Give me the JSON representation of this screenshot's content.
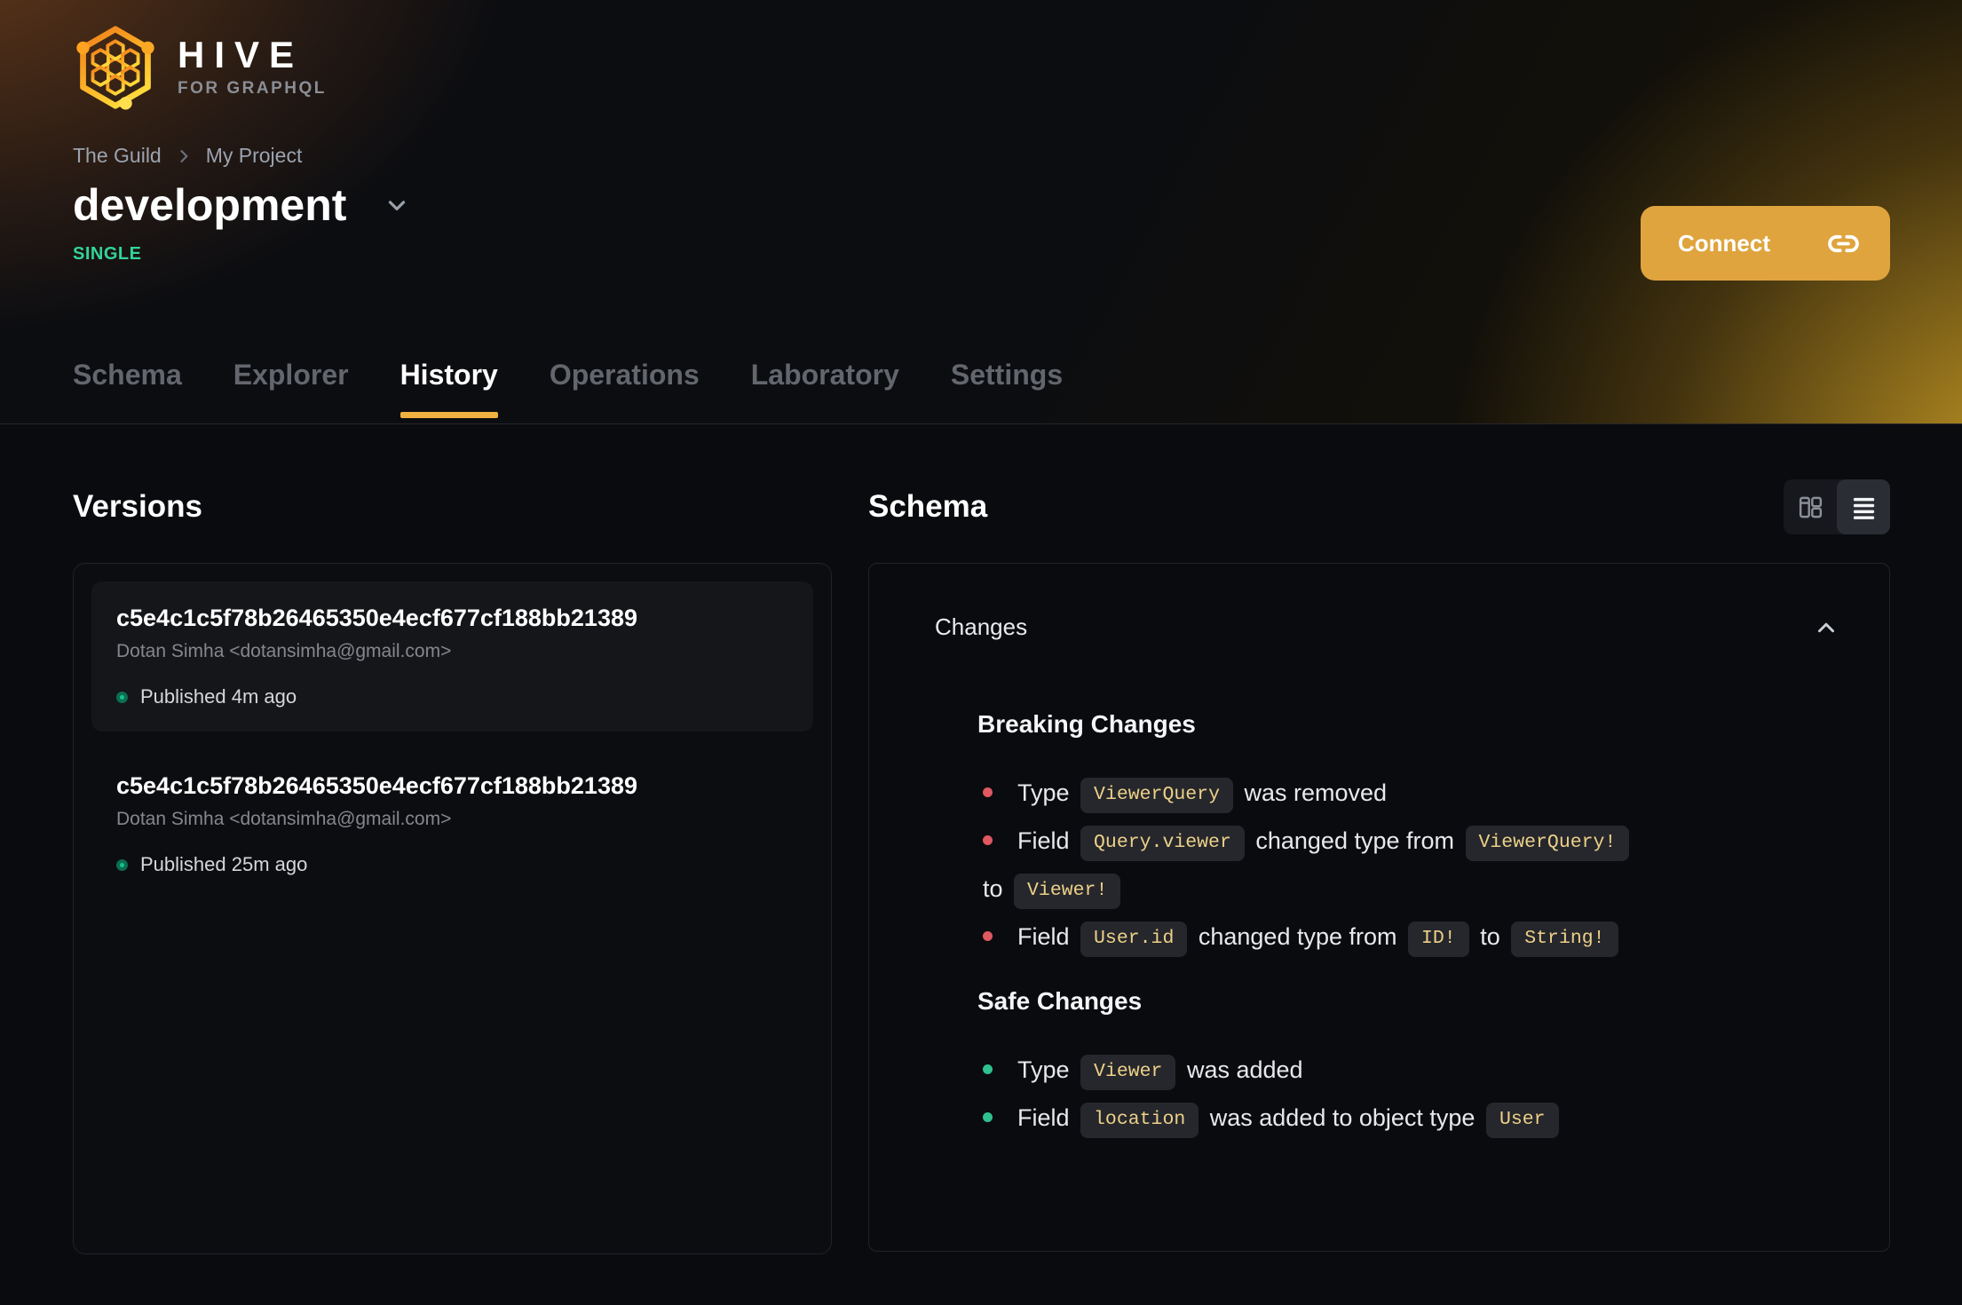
{
  "colors": {
    "accent": "#dfa43e",
    "tab_underline": "#efb13f",
    "badge": "#34d399",
    "breaking_bullet": "#e05861",
    "safe_bullet": "#2fc08f",
    "code_text": "#edd189",
    "brand_orange": "#f07d1c",
    "brand_yellow": "#ffd83a",
    "published_dot": "#19c08d"
  },
  "brand": {
    "name": "HIVE",
    "tagline": "FOR GRAPHQL",
    "logo_icon": "hive-hexagon-logo"
  },
  "breadcrumb": {
    "org": "The Guild",
    "project": "My Project",
    "separator_icon": "chevron-right"
  },
  "target": {
    "name": "development",
    "badge": "SINGLE",
    "dropdown_icon": "chevron-down"
  },
  "connect": {
    "label": "Connect",
    "icon": "link"
  },
  "tabs": [
    {
      "label": "Schema",
      "active": false
    },
    {
      "label": "Explorer",
      "active": false
    },
    {
      "label": "History",
      "active": true
    },
    {
      "label": "Operations",
      "active": false
    },
    {
      "label": "Laboratory",
      "active": false
    },
    {
      "label": "Settings",
      "active": false
    }
  ],
  "versions": {
    "heading": "Versions",
    "items": [
      {
        "hash": "c5e4c1c5f78b26465350e4ecf677cf188bb21389",
        "author": "Dotan Simha <dotansimha@gmail.com>",
        "status": "Published 4m ago",
        "selected": true
      },
      {
        "hash": "c5e4c1c5f78b26465350e4ecf677cf188bb21389",
        "author": "Dotan Simha <dotansimha@gmail.com>",
        "status": "Published 25m ago",
        "selected": false
      }
    ]
  },
  "schema": {
    "heading": "Schema",
    "view_toggle": {
      "split_icon": "columns-view",
      "list_icon": "list-view",
      "active": "list"
    },
    "changes": {
      "title": "Changes",
      "collapse_icon": "chevron-up",
      "breaking": {
        "heading": "Breaking Changes",
        "items": [
          {
            "segments": [
              [
                "text",
                "Type "
              ],
              [
                "code",
                "ViewerQuery"
              ],
              [
                "text",
                " was removed"
              ]
            ]
          },
          {
            "segments": [
              [
                "text",
                "Field "
              ],
              [
                "code",
                "Query.viewer"
              ],
              [
                "text",
                " changed type from "
              ],
              [
                "code",
                "ViewerQuery!"
              ],
              [
                "br",
                ""
              ],
              [
                "text",
                "to "
              ],
              [
                "code",
                "Viewer!"
              ]
            ]
          },
          {
            "segments": [
              [
                "text",
                "Field "
              ],
              [
                "code",
                "User.id"
              ],
              [
                "text",
                " changed type from "
              ],
              [
                "code",
                "ID!"
              ],
              [
                "text",
                " to "
              ],
              [
                "code",
                "String!"
              ]
            ]
          }
        ]
      },
      "safe": {
        "heading": "Safe Changes",
        "items": [
          {
            "segments": [
              [
                "text",
                "Type "
              ],
              [
                "code",
                "Viewer"
              ],
              [
                "text",
                " was added"
              ]
            ]
          },
          {
            "segments": [
              [
                "text",
                "Field "
              ],
              [
                "code",
                "location"
              ],
              [
                "text",
                " was added to object type "
              ],
              [
                "code",
                "User"
              ]
            ]
          }
        ]
      }
    }
  }
}
